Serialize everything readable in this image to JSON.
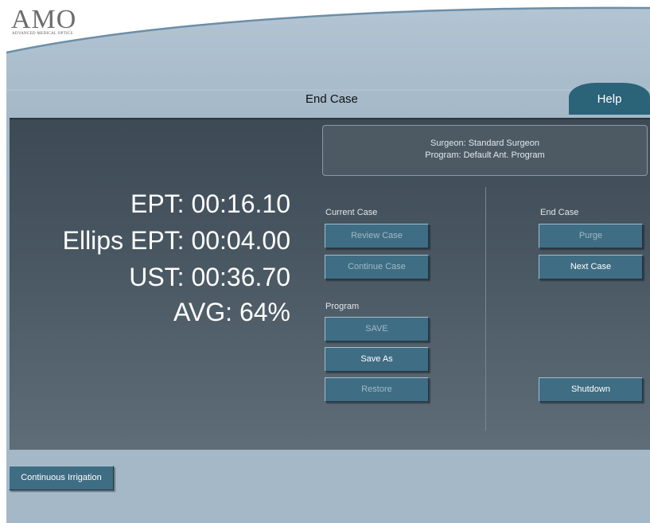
{
  "logo": {
    "main": "AMO",
    "sub": "ADVANCED MEDICAL OPTICS"
  },
  "header": {
    "title": "End Case",
    "help_label": "Help"
  },
  "info": {
    "surgeon": "Surgeon: Standard Surgeon",
    "program": "Program: Default Ant. Program"
  },
  "metrics": {
    "ept": "EPT: 00:16.10",
    "ellips_ept": "Ellips EPT: 00:04.00",
    "ust": "UST: 00:36.70",
    "avg": "AVG: 64%"
  },
  "current_case": {
    "label": "Current Case",
    "review_label": "Review Case",
    "continue_label": "Continue Case"
  },
  "program": {
    "label": "Program",
    "save_label": "SAVE",
    "save_as_label": "Save As",
    "restore_label": "Restore"
  },
  "end_case": {
    "label": "End Case",
    "purge_label": "Purge",
    "next_label": "Next Case",
    "shutdown_label": "Shutdown"
  },
  "footer": {
    "irrigation_label": "Continuous Irrigation"
  },
  "colors": {
    "button": "#3f6d83",
    "help_tab": "#2b6378",
    "background": "#a4b8c8",
    "panel": "#4a5863"
  }
}
